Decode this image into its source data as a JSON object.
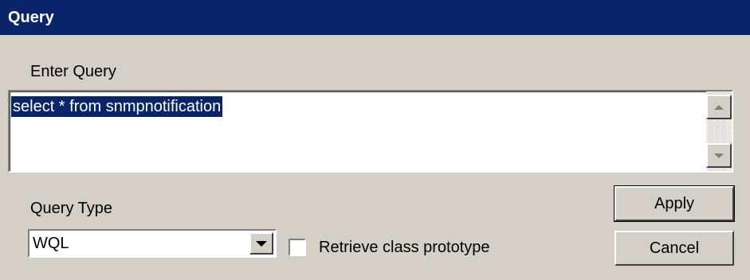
{
  "window": {
    "title": "Query"
  },
  "query": {
    "label": "Enter Query",
    "text": "select * from snmpnotification"
  },
  "query_type": {
    "label": "Query Type",
    "selected": "WQL"
  },
  "retrieve_prototype": {
    "label": "Retrieve class prototype",
    "checked": false
  },
  "buttons": {
    "apply": "Apply",
    "cancel": "Cancel"
  }
}
